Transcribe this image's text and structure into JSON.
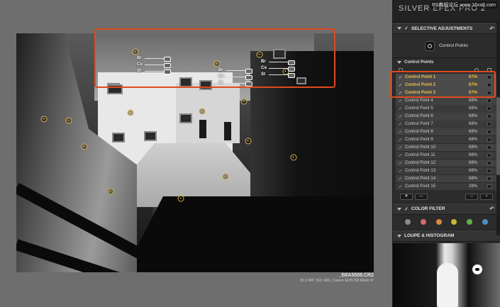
{
  "app": {
    "brand_text": "SILVER EFEX PRO 2",
    "watermark": "PS教程论坛 www.16xx8.com"
  },
  "image_meta": {
    "filename": "_B8A5008.CR2",
    "info": "30.1 MP, ISO 400, Canon EOS 5D Mark IV"
  },
  "photo_overlay": {
    "control_labels": [
      "Br",
      "Co",
      "St"
    ]
  },
  "selective": {
    "title": "SELECTIVE ADJUSTMENTS",
    "tool_label": "Control Points",
    "list_title": "Control Points",
    "points": [
      {
        "name": "Control Point 1",
        "pct": "67%",
        "selected": true
      },
      {
        "name": "Control Point 2",
        "pct": "67%",
        "selected": true
      },
      {
        "name": "Control Point 3",
        "pct": "67%",
        "selected": true
      },
      {
        "name": "Control Point 4",
        "pct": "68%",
        "selected": false
      },
      {
        "name": "Control Point 5",
        "pct": "68%",
        "selected": false
      },
      {
        "name": "Control Point 6",
        "pct": "68%",
        "selected": false
      },
      {
        "name": "Control Point 7",
        "pct": "68%",
        "selected": false
      },
      {
        "name": "Control Point 8",
        "pct": "68%",
        "selected": false
      },
      {
        "name": "Control Point 9",
        "pct": "68%",
        "selected": false
      },
      {
        "name": "Control Point 10",
        "pct": "68%",
        "selected": false
      },
      {
        "name": "Control Point 11",
        "pct": "68%",
        "selected": false
      },
      {
        "name": "Control Point 12",
        "pct": "68%",
        "selected": false
      },
      {
        "name": "Control Point 13",
        "pct": "68%",
        "selected": false
      },
      {
        "name": "Control Point 14",
        "pct": "68%",
        "selected": false
      },
      {
        "name": "Control Point 15",
        "pct": "28%",
        "selected": false
      }
    ]
  },
  "color_filter": {
    "title": "COLOR FILTER",
    "swatches": [
      "#8a8a8a",
      "#d26a6a",
      "#d88a3a",
      "#c7b63a",
      "#5fb24a",
      "#4a90c8"
    ]
  },
  "loupe": {
    "title": "LOUPE & HISTOGRAM"
  },
  "colors": {
    "accent_highlight": "#e04a1f",
    "selected_text": "#f0c040",
    "control_point": "#d8b346"
  }
}
